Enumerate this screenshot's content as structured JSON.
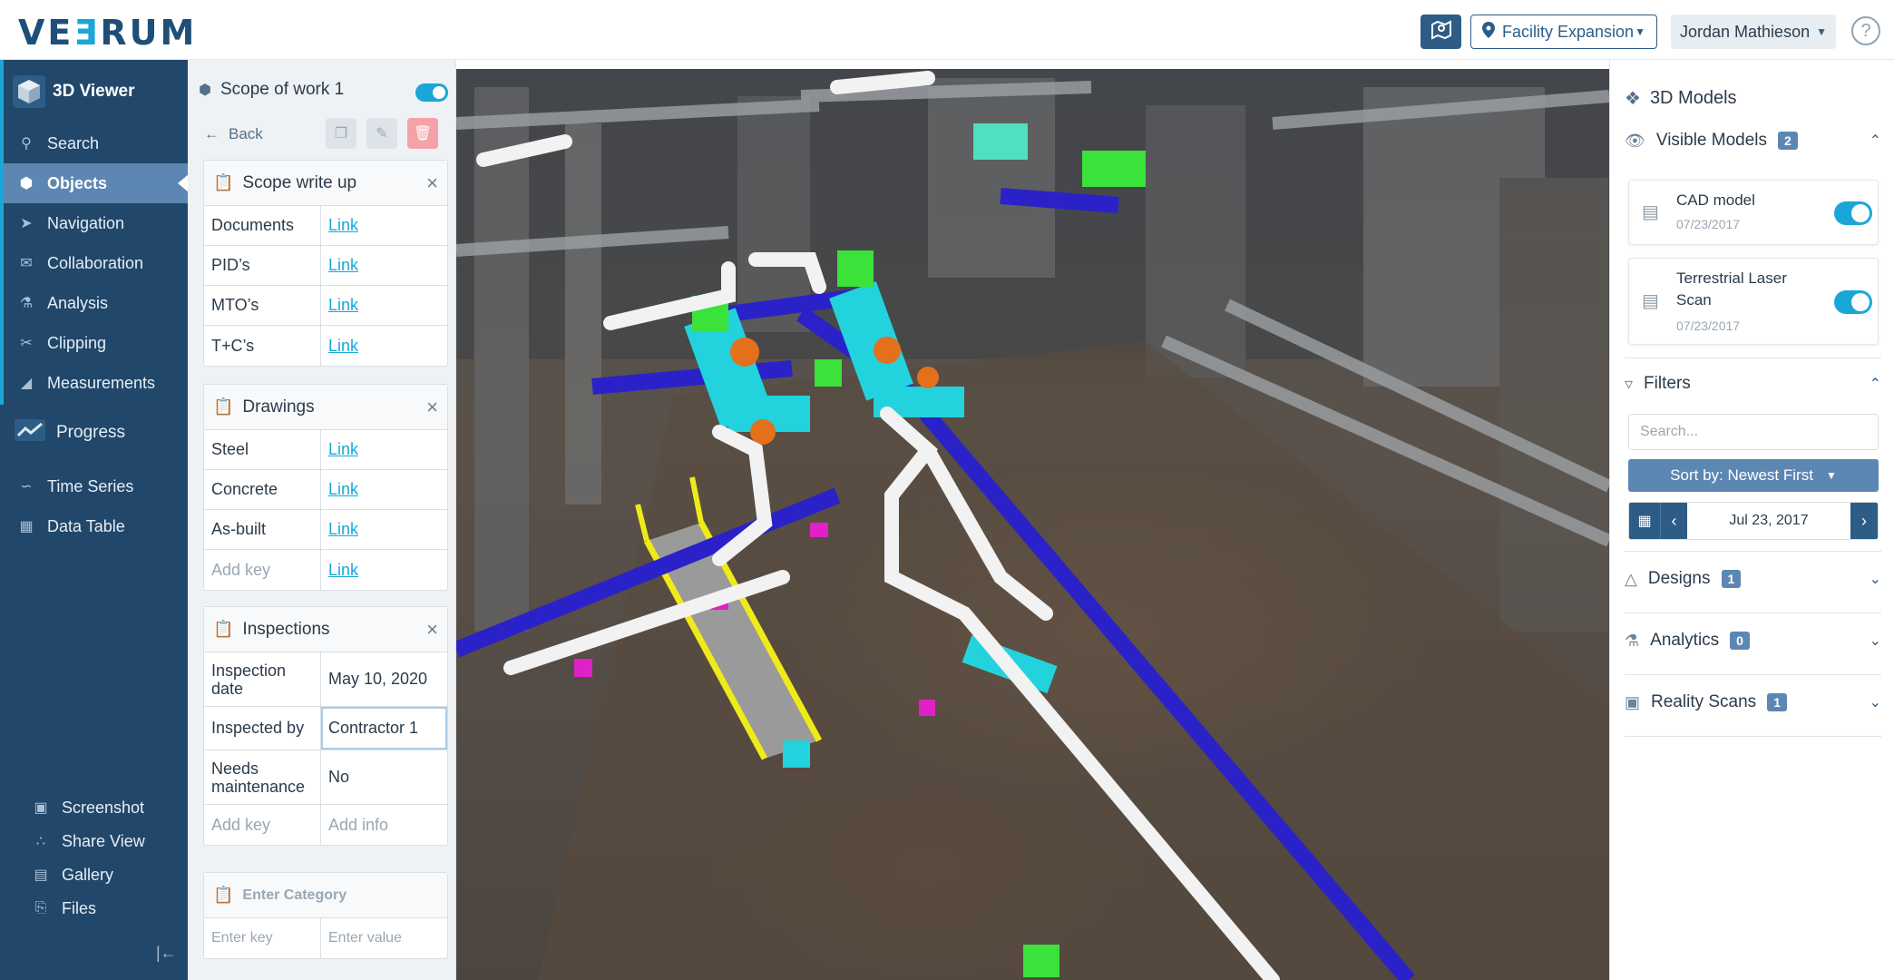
{
  "app": {
    "logo_text": "VEERUM",
    "brand_color": "#1f4e79",
    "accent_color": "#1aa7d8"
  },
  "header": {
    "map_icon": "map-icon",
    "project_label": "Facility Expansion",
    "user_label": "Jordan Mathieson",
    "help_label": "?"
  },
  "sidebar": {
    "title": "3D Viewer",
    "items": [
      {
        "label": "Search",
        "icon": "search-icon"
      },
      {
        "label": "Objects",
        "icon": "cube-icon",
        "active": true
      },
      {
        "label": "Navigation",
        "icon": "navigation-icon"
      },
      {
        "label": "Collaboration",
        "icon": "chat-icon"
      },
      {
        "label": "Analysis",
        "icon": "flask-icon"
      },
      {
        "label": "Clipping",
        "icon": "scissors-icon"
      },
      {
        "label": "Measurements",
        "icon": "ruler-icon"
      }
    ],
    "progress_title": "Progress",
    "progress_items": [
      {
        "label": "Time Series",
        "icon": "chart-icon"
      },
      {
        "label": "Data Table",
        "icon": "table-icon"
      }
    ],
    "bottom_items": [
      {
        "label": "Screenshot",
        "icon": "camera-icon"
      },
      {
        "label": "Share View",
        "icon": "share-icon"
      },
      {
        "label": "Gallery",
        "icon": "gallery-icon"
      },
      {
        "label": "Files",
        "icon": "file-icon"
      }
    ]
  },
  "object_panel": {
    "title": "Scope of work 1",
    "visible": true,
    "back_label": "Back",
    "cards": [
      {
        "title": "Scope write up",
        "rows": [
          {
            "key": "Documents",
            "value": "Link",
            "is_link": true
          },
          {
            "key": "PID’s",
            "value": "Link",
            "is_link": true
          },
          {
            "key": "MTO’s",
            "value": "Link",
            "is_link": true
          },
          {
            "key": "T+C’s",
            "value": "Link",
            "is_link": true
          }
        ]
      },
      {
        "title": "Drawings",
        "rows": [
          {
            "key": "Steel",
            "value": "Link",
            "is_link": true
          },
          {
            "key": "Concrete",
            "value": "Link",
            "is_link": true
          },
          {
            "key": "As-built",
            "value": "Link",
            "is_link": true
          },
          {
            "key": "Add key",
            "value": "Link",
            "is_link": true,
            "key_placeholder": true
          }
        ]
      },
      {
        "title": "Inspections",
        "rows": [
          {
            "key": "Inspection date",
            "value": "May 10, 2020"
          },
          {
            "key": "Inspected by",
            "value": "Contractor 1"
          },
          {
            "key": "Needs maintenance",
            "value": "No"
          },
          {
            "key": "Add key",
            "value": "Add info",
            "key_placeholder": true,
            "value_placeholder": true
          }
        ]
      }
    ],
    "new_category": {
      "placeholder": "Enter Category",
      "key_placeholder": "Enter key",
      "value_placeholder": "Enter value"
    }
  },
  "right_panel": {
    "title": "3D Models",
    "visible_models": {
      "label": "Visible Models",
      "count": "2",
      "models": [
        {
          "name": "CAD model",
          "date": "07/23/2017",
          "enabled": true
        },
        {
          "name": "Terrestrial Laser Scan",
          "date": "07/23/2017",
          "enabled": true
        }
      ]
    },
    "filters": {
      "label": "Filters",
      "search_placeholder": "Search...",
      "sort_label": "Sort by: Newest First",
      "date_label": "Jul 23, 2017"
    },
    "sections": [
      {
        "label": "Designs",
        "count": "1",
        "icon": "designs-icon"
      },
      {
        "label": "Analytics",
        "count": "0",
        "icon": "flask-icon"
      },
      {
        "label": "Reality Scans",
        "count": "1",
        "icon": "map-icon"
      }
    ]
  },
  "viewport": {
    "description_colors": {
      "pipe_white": "#f2f2f2",
      "pipe_blue": "#2a22c8",
      "steel_cyan": "#22d3dd",
      "steel_green": "#3ae23a",
      "stair_yellow": "#f0ea18",
      "valve_orange": "#e4701c",
      "magenta": "#e020c8"
    }
  }
}
